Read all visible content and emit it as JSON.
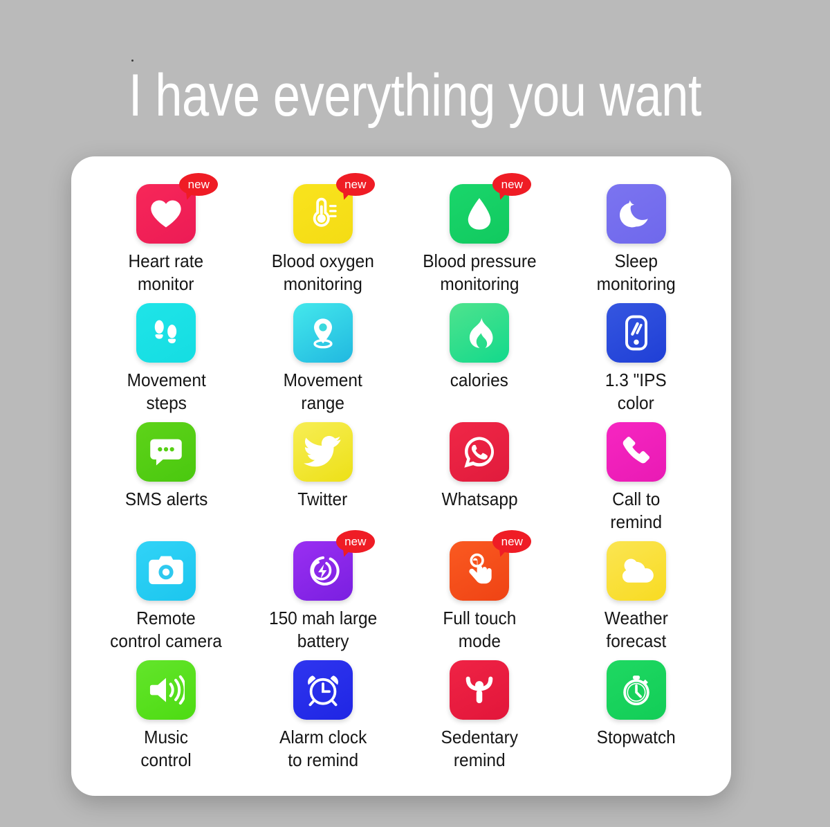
{
  "header": {
    "title": "I have everything you want"
  },
  "badges": {
    "new_label": "new"
  },
  "features": [
    {
      "label": "Heart rate\nmonitor",
      "icon": "heart-icon",
      "tile_color": "#f72759",
      "tile_color2": "#ec1b55",
      "badge": true
    },
    {
      "label": "Blood oxygen\nmonitoring",
      "icon": "thermometer-icon",
      "tile_color": "#f9e31e",
      "tile_color2": "#f4dc14",
      "badge": true
    },
    {
      "label": "Blood pressure\nmonitoring",
      "icon": "water-drop-icon",
      "tile_color": "#1ad66b",
      "tile_color2": "#11c95f",
      "badge": true
    },
    {
      "label": "Sleep\nmonitoring",
      "icon": "moon-star-icon",
      "tile_color": "#7b74f0",
      "tile_color2": "#6f68ec",
      "badge": false
    },
    {
      "label": "Movement\nsteps",
      "icon": "footsteps-icon",
      "tile_color": "#1fe4e8",
      "tile_color2": "#15dde2",
      "badge": false
    },
    {
      "label": "Movement\nrange",
      "icon": "location-pin-icon",
      "tile_color": "#44e8ec",
      "tile_color2": "#21b8e0",
      "badge": false
    },
    {
      "label": "calories",
      "icon": "flame-icon",
      "tile_color": "#4fe38d",
      "tile_color2": "#12d98c",
      "badge": false
    },
    {
      "label": "1.3 \"IPS\ncolor",
      "icon": "display-screen-icon",
      "tile_color": "#3556e0",
      "tile_color2": "#1f3fd6",
      "badge": false
    },
    {
      "label": "SMS alerts",
      "icon": "sms-bubble-icon",
      "tile_color": "#5ed319",
      "tile_color2": "#4ac80f",
      "badge": false
    },
    {
      "label": "Twitter",
      "icon": "twitter-bird-icon",
      "tile_color": "#f7ee55",
      "tile_color2": "#ede017",
      "badge": false
    },
    {
      "label": "Whatsapp",
      "icon": "whatsapp-icon",
      "tile_color": "#f02747",
      "tile_color2": "#e01b3c",
      "badge": false
    },
    {
      "label": "Call to\nremind",
      "icon": "phone-handset-icon",
      "tile_color": "#f626c1",
      "tile_color2": "#e91ab4",
      "badge": false
    },
    {
      "label": "Remote\ncontrol camera",
      "icon": "camera-icon",
      "tile_color": "#31d3f7",
      "tile_color2": "#1cc6ee",
      "badge": false
    },
    {
      "label": "150 mah large\nbattery",
      "icon": "battery-charge-icon",
      "tile_color": "#9a2ff2",
      "tile_color2": "#7a1fe0",
      "badge": true
    },
    {
      "label": "Full touch\nmode",
      "icon": "touch-hand-icon",
      "tile_color": "#fa5a21",
      "tile_color2": "#ef4314",
      "badge": true
    },
    {
      "label": "Weather\nforecast",
      "icon": "sun-cloud-icon",
      "tile_color": "#fbe552",
      "tile_color2": "#f8db22",
      "badge": false
    },
    {
      "label": "Music\ncontrol",
      "icon": "speaker-volume-icon",
      "tile_color": "#63e52b",
      "tile_color2": "#4ddb12",
      "badge": false
    },
    {
      "label": "Alarm clock\nto remind",
      "icon": "alarm-clock-icon",
      "tile_color": "#2f35ef",
      "tile_color2": "#1f26e4",
      "badge": false
    },
    {
      "label": "Sedentary\nremind",
      "icon": "person-stretch-icon",
      "tile_color": "#ef2345",
      "tile_color2": "#e2163a",
      "badge": false
    },
    {
      "label": "Stopwatch",
      "icon": "stopwatch-icon",
      "tile_color": "#1fd862",
      "tile_color2": "#12cd57",
      "badge": false
    }
  ],
  "theme": {
    "background": "#bababa",
    "card_background": "#ffffff",
    "title_color": "#ffffff",
    "label_color": "#151515",
    "badge_color": "#ef1c25"
  }
}
